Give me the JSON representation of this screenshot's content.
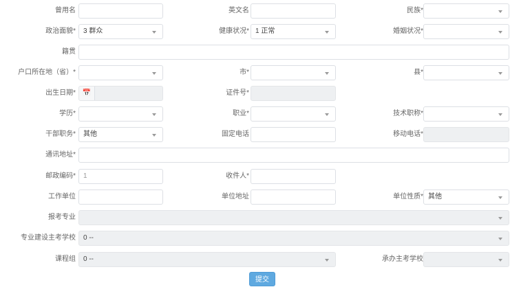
{
  "form": {
    "former_name_label": "曾用名",
    "english_name_label": "英文名",
    "ethnicity_label": "民族*",
    "political_status_label": "政治面貌*",
    "political_status_value": "3 群众",
    "health_status_label": "健康状况*",
    "health_status_value": "1 正常",
    "marital_status_label": "婚姻状况*",
    "native_place_label": "籍贯",
    "hukou_province_label": "户口所在地（省）*",
    "city_label": "市*",
    "county_label": "县*",
    "birth_date_label": "出生日期*",
    "id_number_label": "证件号*",
    "education_label": "学历*",
    "occupation_label": "职业*",
    "tech_title_label": "技术职称*",
    "cadre_position_label": "干部职务*",
    "cadre_position_value": "其他",
    "landline_label": "固定电话",
    "mobile_label": "移动电话*",
    "address_label": "通讯地址*",
    "postcode_label": "邮政编码*",
    "postcode_value": "1",
    "recipient_label": "收件人*",
    "work_unit_label": "工作单位",
    "work_address_label": "单位地址",
    "unit_type_label": "单位性质*",
    "unit_type_value": "其他",
    "major_label": "报考专业",
    "main_school_label": "专业建设主考学校",
    "main_school_value": "0 --",
    "course_label": "课程组",
    "course_value": "0 --",
    "assist_school_label": "承办主考学校",
    "submit_label": "提交"
  },
  "icons": {
    "calendar": "calendar-icon",
    "dropdown": "chevron-down-icon"
  }
}
